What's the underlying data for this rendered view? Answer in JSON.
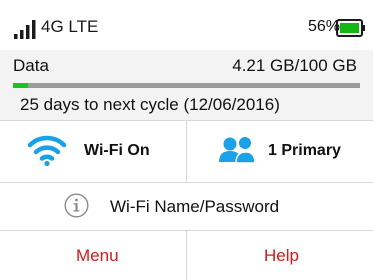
{
  "statusbar": {
    "network": "4G LTE",
    "battery_percent": "56%",
    "battery_level": 0.56,
    "signal_bars_lit": 4,
    "signal_icon": "signal-bars-icon",
    "battery_icon": "battery-icon"
  },
  "data": {
    "label": "Data",
    "usage": "4.21 GB/100 GB",
    "used_fraction": 0.0421,
    "cycle_text": "25 days to next cycle (12/06/2016)"
  },
  "tiles": {
    "wifi_label": "Wi-Fi On",
    "wifi_icon": "wifi-icon",
    "primary_label": "1 Primary",
    "primary_icon": "users-icon"
  },
  "wifi_password": {
    "label": "Wi-Fi Name/Password",
    "icon": "info-icon"
  },
  "footer": {
    "menu_label": "Menu",
    "help_label": "Help"
  },
  "colors": {
    "accent_red": "#d11a1a",
    "wifi_blue": "#1aa1e8",
    "progress_green": "#19c41f",
    "battery_green": "#14b814"
  }
}
